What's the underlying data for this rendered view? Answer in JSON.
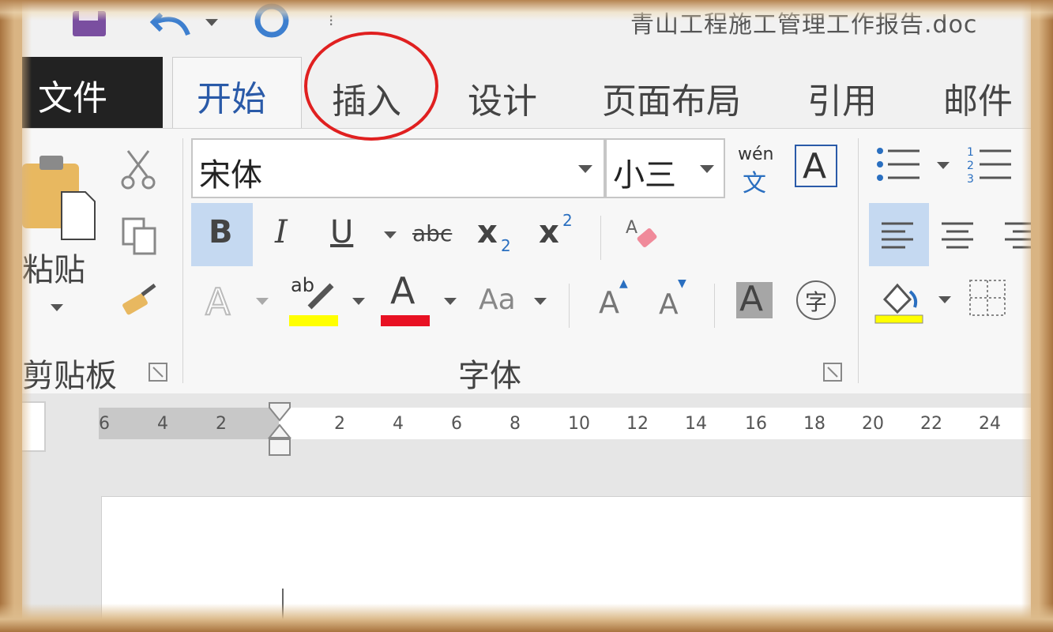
{
  "title_bar": {
    "text": "青山工程施工管理工作报告.doc"
  },
  "tabs": {
    "file": "文件",
    "home": "开始",
    "insert": "插入",
    "design": "设计",
    "layout": "页面布局",
    "references": "引用",
    "mailings": "邮件"
  },
  "clipboard": {
    "paste_label": "粘贴",
    "group_label": "剪贴板"
  },
  "font": {
    "name": "宋体",
    "size": "小三",
    "group_label": "字体",
    "phonetic_top": "wén",
    "phonetic_bottom": "文",
    "border_char": "A",
    "bold": "B",
    "italic": "I",
    "underline": "U",
    "strike": "abc",
    "subscript": "x",
    "subscript_small": "2",
    "superscript": "x",
    "superscript_small": "2",
    "effects": "A",
    "highlight": "ab",
    "font_color": "A",
    "case": "Aa",
    "grow": "A",
    "shrink": "A",
    "shade": "A",
    "enclose": "字",
    "highlight_color": "#ffff00",
    "font_color_color": "#e81123"
  },
  "ruler": {
    "ticks": [
      "6",
      "4",
      "2",
      "2",
      "4",
      "6",
      "8",
      "10",
      "12",
      "14",
      "16",
      "18",
      "20",
      "22",
      "24"
    ]
  },
  "annotation": {
    "color": "#e02020"
  }
}
